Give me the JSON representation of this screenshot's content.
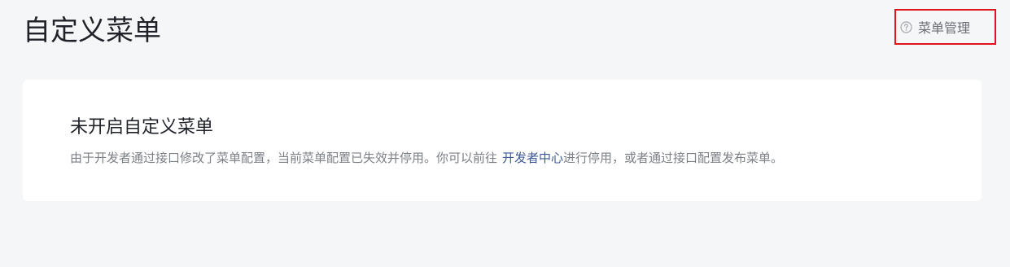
{
  "header": {
    "title": "自定义菜单",
    "help_link": {
      "icon": "question-circle-icon",
      "label": "菜单管理"
    }
  },
  "notice_card": {
    "title": "未开启自定义菜单",
    "desc_before": "由于开发者通过接口修改了菜单配置，当前菜单配置已失效并停用。你可以前往",
    "link_text": "开发者中心",
    "desc_after": "进行停用，或者通过接口配置发布菜单。"
  },
  "colors": {
    "background": "#f5f6f8",
    "card": "#ffffff",
    "link": "#3b5998",
    "highlight_border": "#e0141d"
  }
}
